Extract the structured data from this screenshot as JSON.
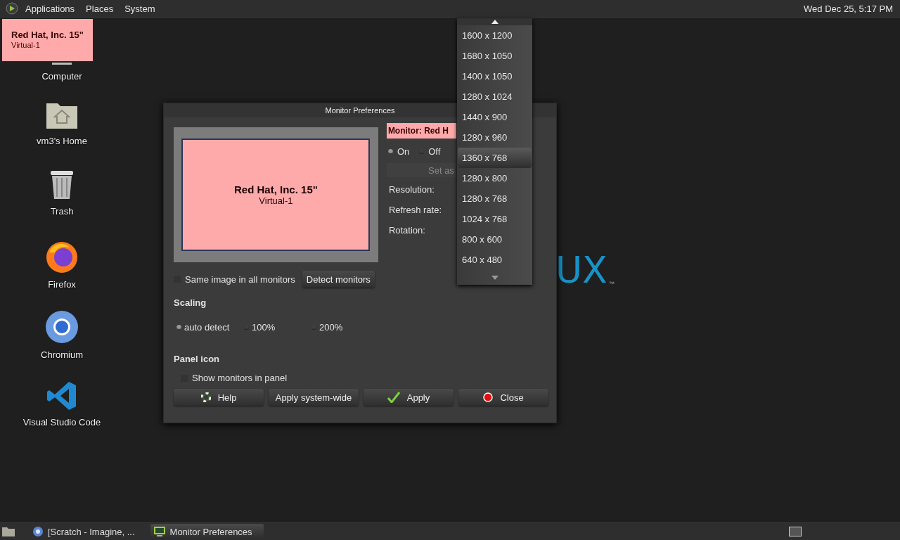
{
  "top_panel": {
    "menus": [
      "Applications",
      "Places",
      "System"
    ],
    "clock": "Wed Dec 25,  5:17 PM"
  },
  "desktop_icons": [
    {
      "label": "Computer",
      "kind": "computer"
    },
    {
      "label": "vm3's Home",
      "kind": "home"
    },
    {
      "label": "Trash",
      "kind": "trash"
    },
    {
      "label": "Firefox",
      "kind": "firefox"
    },
    {
      "label": "Chromium",
      "kind": "chromium"
    },
    {
      "label": "Visual Studio Code",
      "kind": "vscode"
    }
  ],
  "monitor_overlay": {
    "name": "Red Hat, Inc. 15\"",
    "output": "Virtual-1"
  },
  "wallpaper_logo": {
    "text": "UX",
    "trademark": "™"
  },
  "dialog": {
    "title": "Monitor Preferences",
    "preview": {
      "name": "Red Hat, Inc. 15\"",
      "output": "Virtual-1"
    },
    "monitor_label": "Monitor: Red H",
    "power": [
      {
        "label": "On",
        "selected": true
      },
      {
        "label": "Off",
        "selected": false
      }
    ],
    "set_as_button": "Set as",
    "field_labels": [
      "Resolution:",
      "Refresh rate:",
      "Rotation:"
    ],
    "same_image": {
      "label": "Same image in all monitors",
      "checked": false
    },
    "detect_button": "Detect monitors",
    "scaling": {
      "heading": "Scaling",
      "options": [
        {
          "label": "auto detect",
          "selected": true
        },
        {
          "label": "100%",
          "selected": false
        },
        {
          "label": "200%",
          "selected": false
        }
      ]
    },
    "panel_icon": {
      "heading": "Panel icon",
      "show_monitors": {
        "label": "Show monitors in panel",
        "checked": false
      }
    },
    "buttons": [
      {
        "label": "Help",
        "kind": "help"
      },
      {
        "label": "Apply system-wide",
        "kind": "plain"
      },
      {
        "label": "Apply",
        "kind": "apply"
      },
      {
        "label": "Close",
        "kind": "close"
      }
    ]
  },
  "resolution_menu": {
    "items": [
      {
        "label": "1600 x 1200",
        "selected": false
      },
      {
        "label": "1680 x 1050",
        "selected": false
      },
      {
        "label": "1400 x 1050",
        "selected": false
      },
      {
        "label": "1280 x 1024",
        "selected": false
      },
      {
        "label": "1440 x 900",
        "selected": false
      },
      {
        "label": "1280 x 960",
        "selected": false
      },
      {
        "label": "1360 x 768",
        "selected": true
      },
      {
        "label": "1280 x 800",
        "selected": false
      },
      {
        "label": "1280 x 768",
        "selected": false
      },
      {
        "label": "1024 x 768",
        "selected": false
      },
      {
        "label": "800 x 600",
        "selected": false
      },
      {
        "label": "640 x 480",
        "selected": false
      }
    ]
  },
  "taskbar": {
    "items": [
      {
        "label": "[Scratch - Imagine, ...",
        "kind": "browser",
        "selected": false
      },
      {
        "label": "Monitor Preferences",
        "kind": "monitor",
        "selected": true
      }
    ]
  }
}
